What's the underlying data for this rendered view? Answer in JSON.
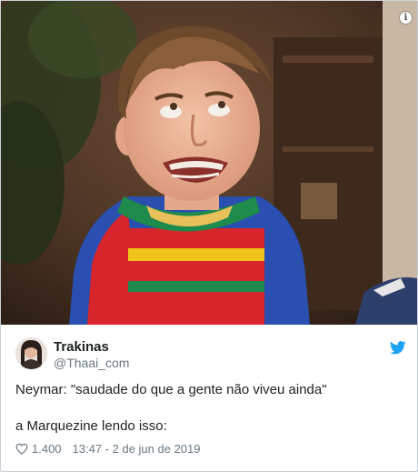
{
  "tweet": {
    "display_name": "Trakinas",
    "handle": "@Thaai_com",
    "text_line1": "Neymar: \"saudade do que a gente não viveu ainda\"",
    "text_line2": "a Marquezine lendo isso:",
    "likes": "1.400",
    "timestamp": "13:47 - 2 de jun de 2019"
  },
  "icons": {
    "info": "info-icon",
    "brand": "twitter-bird-icon",
    "like": "heart-icon"
  },
  "colors": {
    "brand_blue": "#1da1f2",
    "secondary_text": "#697882",
    "primary_text": "#1c2022"
  }
}
